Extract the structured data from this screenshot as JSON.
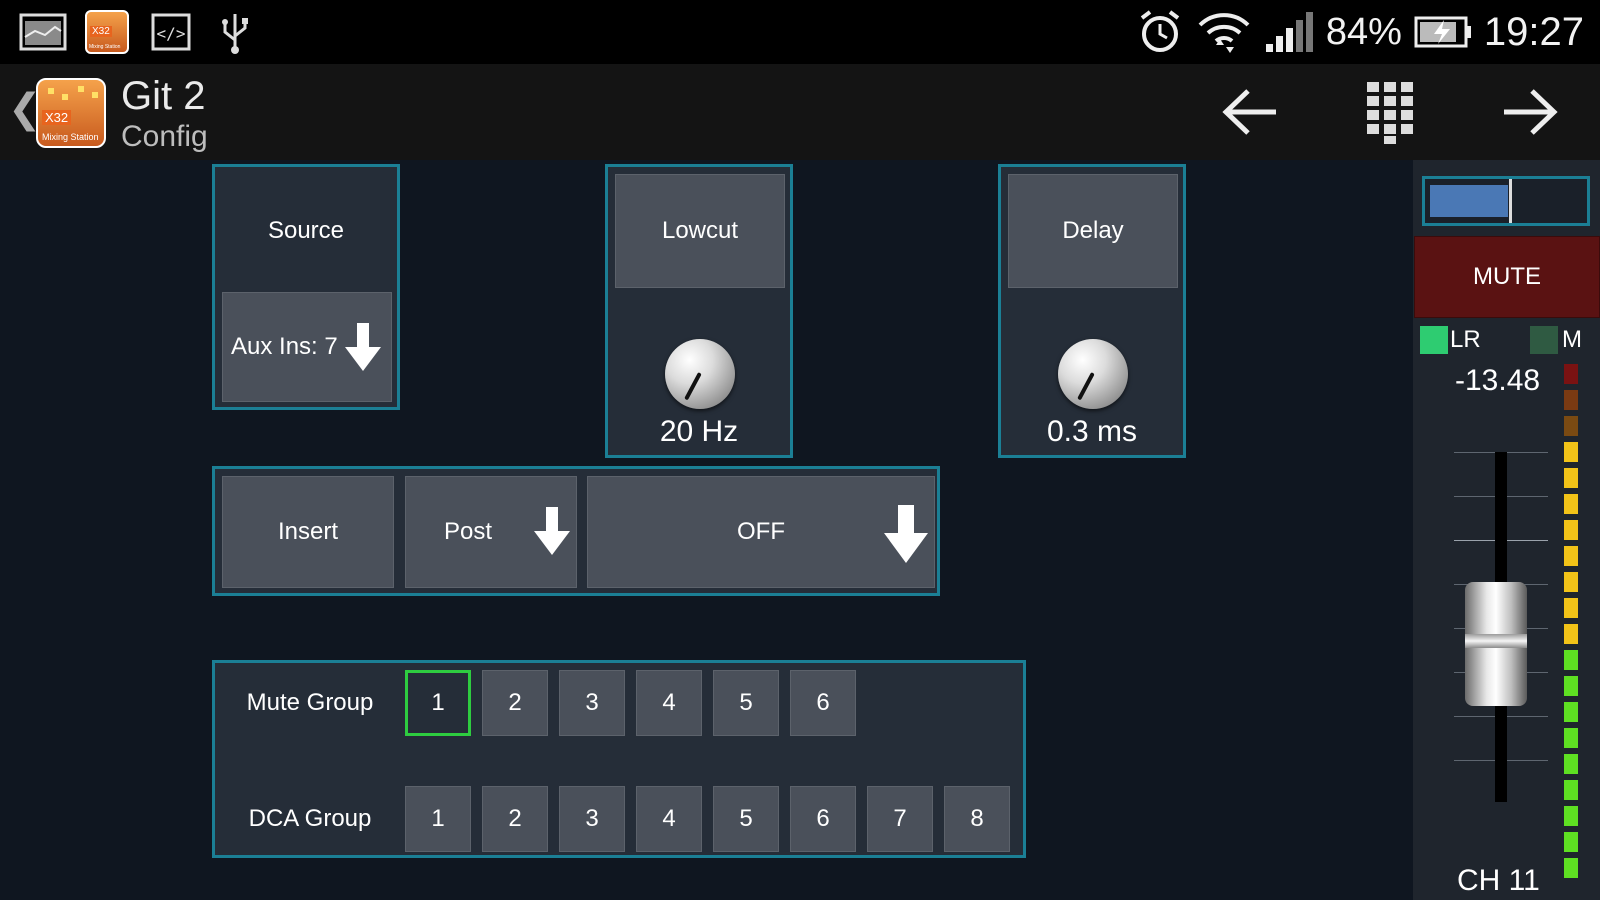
{
  "status_bar": {
    "icons": [
      "gallery-icon",
      "x32-app-icon",
      "code-icon",
      "usb-icon"
    ],
    "right_icons": [
      "alarm-icon",
      "wifi-icon",
      "signal-icon",
      "battery-charging-icon"
    ],
    "battery_percent": "84%",
    "time": "19:27",
    "app_icon_text": "X32",
    "app_icon_sub": "Mixing Station"
  },
  "action_bar": {
    "back_chevron": "❮",
    "title": "Git 2",
    "subtitle": "Config",
    "logo_text": "X32",
    "logo_sub": "Mixing Station",
    "buttons": [
      "arrow-left-icon",
      "keypad-icon",
      "arrow-right-icon"
    ]
  },
  "source": {
    "label": "Source",
    "value": "Aux Ins: 7"
  },
  "lowcut": {
    "label": "Lowcut",
    "value": "20 Hz"
  },
  "delay": {
    "label": "Delay",
    "value": "0.3 ms"
  },
  "insert": {
    "label": "Insert",
    "position": "Post",
    "fx": "OFF"
  },
  "mute_group": {
    "label": "Mute Group",
    "items": [
      "1",
      "2",
      "3",
      "4",
      "5",
      "6"
    ],
    "active": "1"
  },
  "dca_group": {
    "label": "DCA Group",
    "items": [
      "1",
      "2",
      "3",
      "4",
      "5",
      "6",
      "7",
      "8"
    ]
  },
  "channel_strip": {
    "mute_label": "MUTE",
    "lr_label": "LR",
    "m_label": "M",
    "fader_value": "-13.48",
    "channel": "CH 11",
    "colors": {
      "panel_border": "#1b7f95",
      "mute_bg": "#5a1212",
      "lr_on": "#2ecc71",
      "active_group": "#2ecc40"
    }
  }
}
